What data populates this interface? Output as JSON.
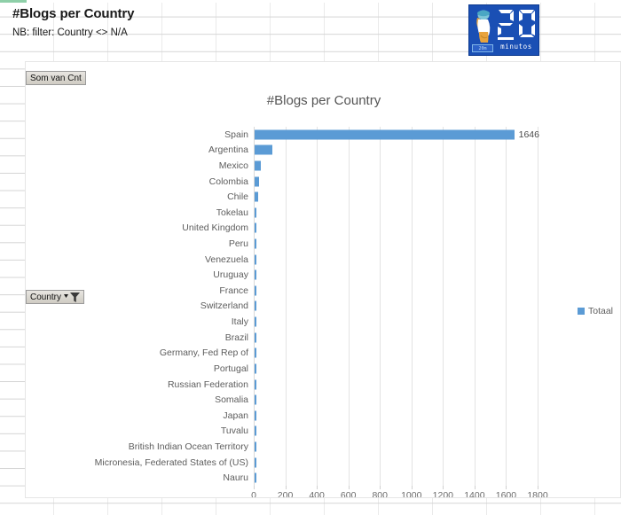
{
  "sheet": {
    "title_cell": "#Blogs per Country",
    "note_cell": "NB: filter: Country <> N/A"
  },
  "logo": {
    "number": "20",
    "word": "minutos",
    "badge": "20m",
    "bg_color": "#1a4fb4"
  },
  "pivot": {
    "value_field_button": "Som van Cnt",
    "row_field_button": "Country",
    "filter_icon": "filter-funnel-icon",
    "dropdown_icon": "chevron-down-icon"
  },
  "legend": {
    "position": "right",
    "entries": [
      "Totaal"
    ]
  },
  "chart_data": {
    "type": "bar",
    "orientation": "horizontal",
    "title": "#Blogs per Country",
    "xlabel": "",
    "ylabel": "",
    "xlim": [
      0,
      1800
    ],
    "xticks": [
      0,
      200,
      400,
      600,
      800,
      1000,
      1200,
      1400,
      1600,
      1800
    ],
    "grid": true,
    "series_name": "Totaal",
    "series_color": "#5b9bd5",
    "data_labels_shown": [
      "1646"
    ],
    "categories": [
      "Spain",
      "Argentina",
      "Mexico",
      "Colombia",
      "Chile",
      "Tokelau",
      "United Kingdom",
      "Peru",
      "Venezuela",
      "Uruguay",
      "France",
      "Switzerland",
      "Italy",
      "Brazil",
      "Germany, Fed Rep of",
      "Portugal",
      "Russian Federation",
      "Somalia",
      "Japan",
      "Tuvalu",
      "British Indian Ocean Territory",
      "Micronesia, Federated States of (US)",
      "Nauru"
    ],
    "values": [
      1646,
      110,
      42,
      26,
      20,
      4,
      4,
      3,
      3,
      3,
      2,
      2,
      2,
      2,
      1,
      1,
      1,
      1,
      1,
      1,
      1,
      1,
      1
    ],
    "labels": [
      "1646",
      "",
      "",
      "",
      "",
      "",
      "",
      "",
      "",
      "",
      "",
      "",
      "",
      "",
      "",
      "",
      "",
      "",
      "",
      "",
      "",
      "",
      ""
    ]
  }
}
